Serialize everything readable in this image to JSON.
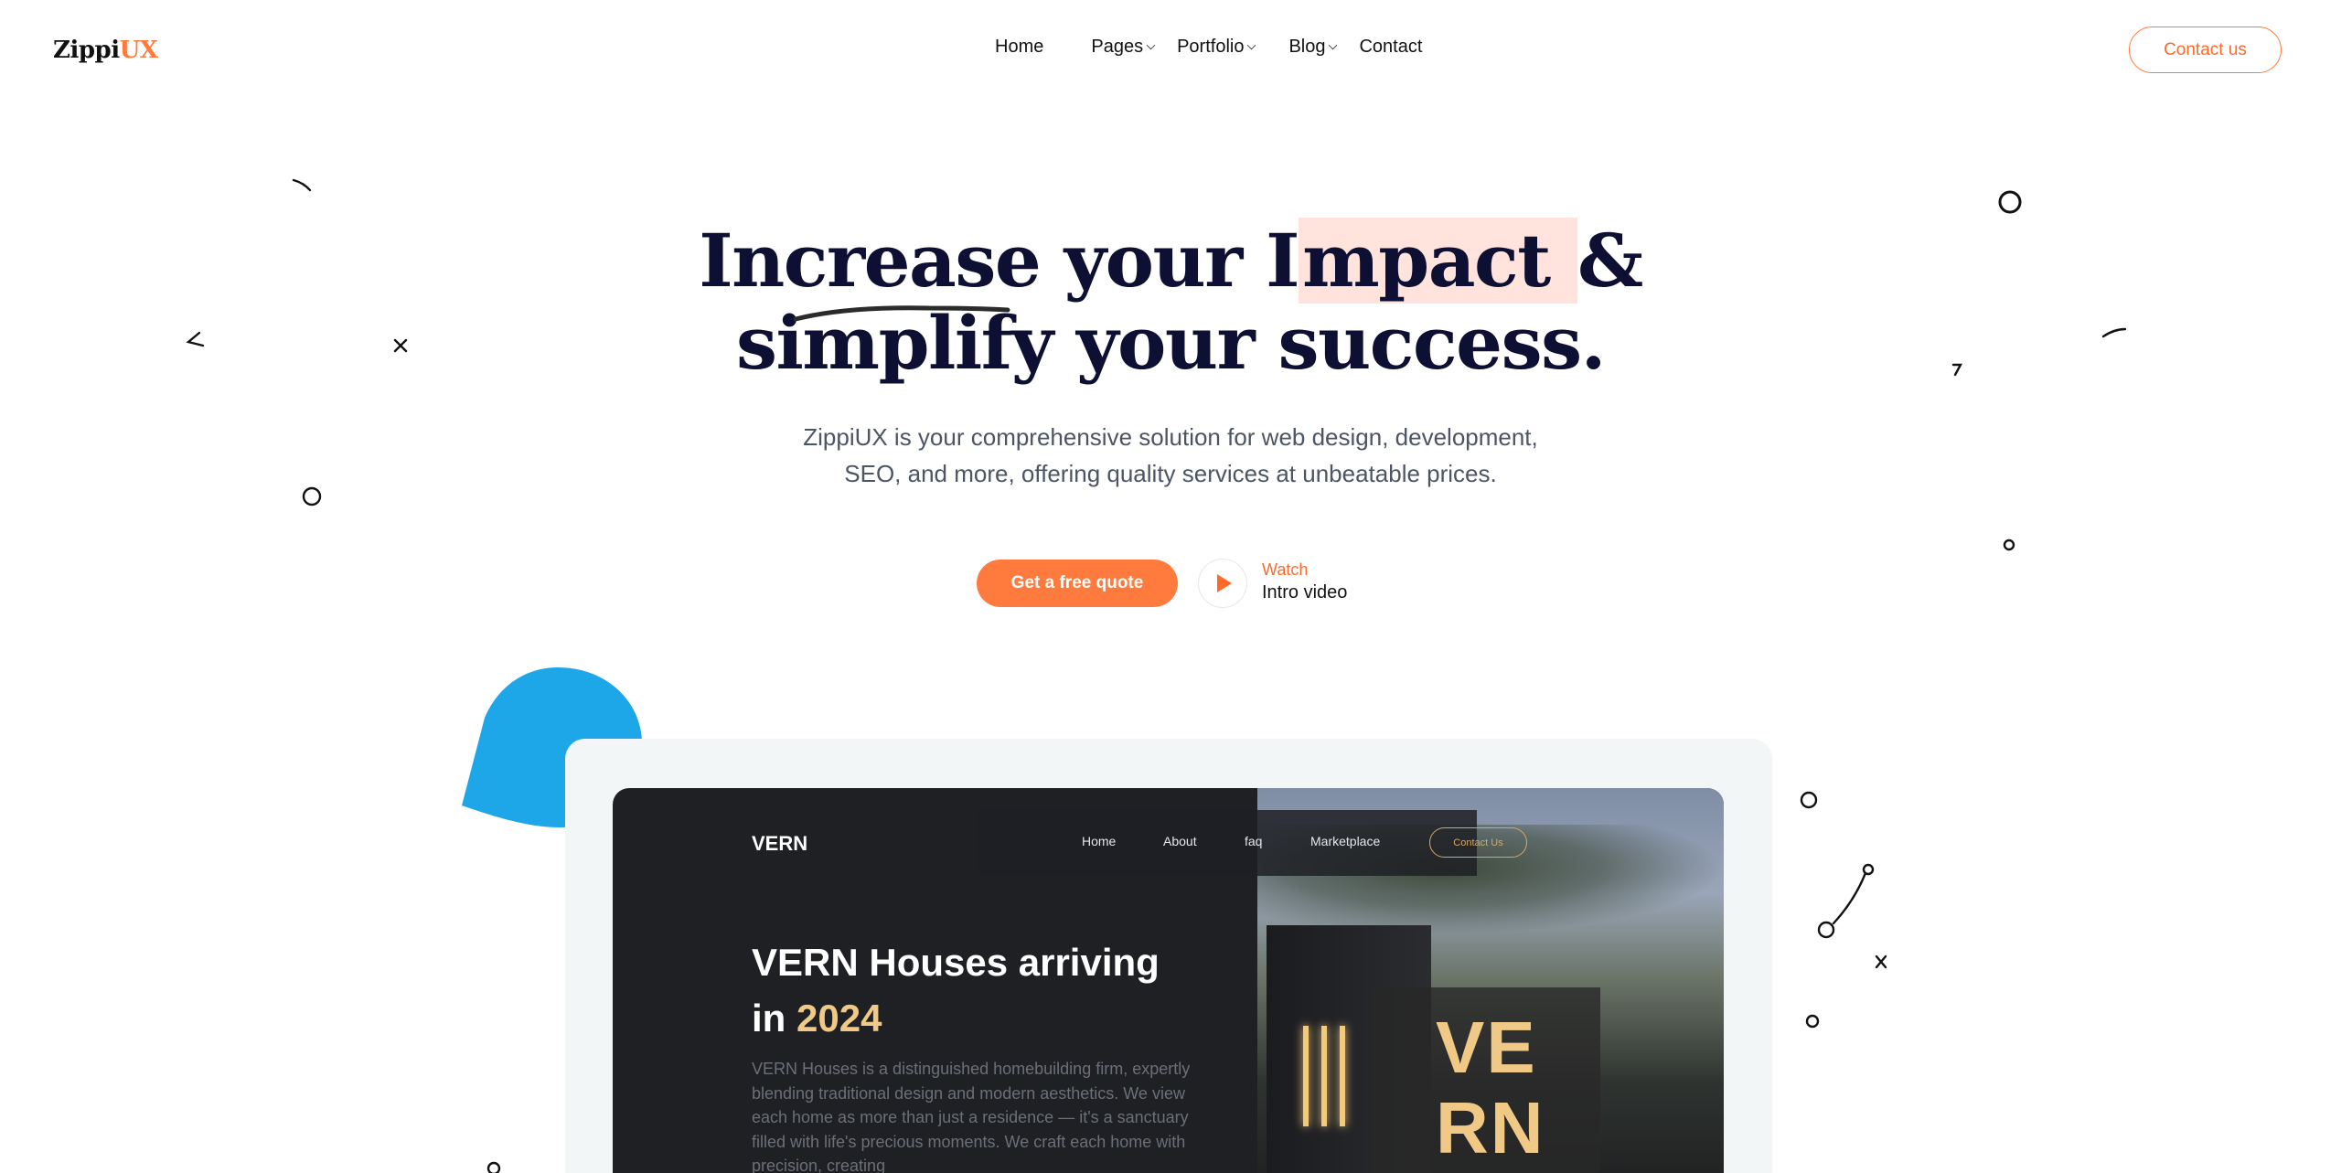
{
  "brand": {
    "logo_main": "Zippi",
    "logo_accent": "UX",
    "accent_color": "#ff7a3d"
  },
  "nav": {
    "items": [
      {
        "label": "Home",
        "has_dropdown": false
      },
      {
        "label": "Pages",
        "has_dropdown": true
      },
      {
        "label": "Portfolio",
        "has_dropdown": true
      },
      {
        "label": "Blog",
        "has_dropdown": true
      },
      {
        "label": "Contact",
        "has_dropdown": false
      }
    ],
    "cta_label": "Contact us"
  },
  "hero": {
    "title_part1": "Increase your I",
    "title_highlight": "mpact ",
    "title_part2": "&",
    "title_line2": "simplify your success.",
    "subtitle_line1": "ZippiUX is your comprehensive solution for web design, development,",
    "subtitle_line2": "SEO, and more, offering quality services at unbeatable prices.",
    "primary_cta": "Get a free quote",
    "video_small": "Watch",
    "video_label": "Intro video"
  },
  "mockup": {
    "brand": "VERN",
    "nav": [
      "Home",
      "About",
      "faq",
      "Marketplace"
    ],
    "contact_label": "Contact Us",
    "title_line1": "VERN Houses arriving",
    "title_in": "in",
    "title_year": "2024",
    "body": "VERN Houses is a distinguished homebuilding firm, expertly blending traditional design and modern aesthetics. We view each home as more than just a residence — it's a sanctuary filled with life's precious moments. We craft each home with precision, creating",
    "photo_letters_1": "VE",
    "photo_letters_2": "RN",
    "gold_color": "#f0c987"
  },
  "decorations": {
    "blob_color": "#1ea7e8"
  }
}
